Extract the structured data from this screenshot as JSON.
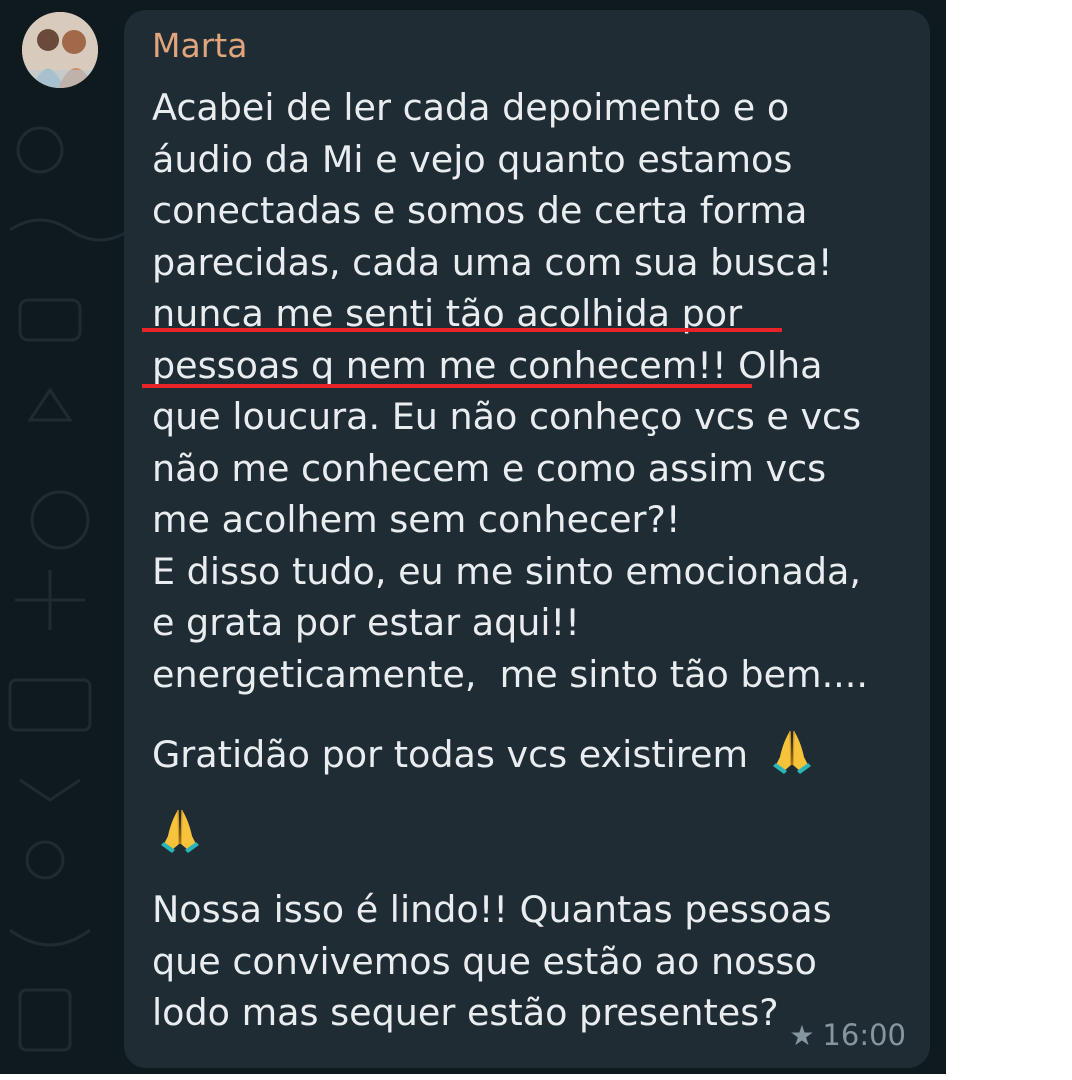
{
  "message": {
    "sender": "Marta",
    "lines": [
      "Acabei de ler cada depoimento e o",
      "áudio da Mi e vejo quanto estamos",
      "conectadas e somos de certa forma",
      "parecidas, cada uma com sua busca!",
      "nunca me senti tão acolhida por",
      "pessoas q nem me conhecem!! Olha",
      "que loucura. Eu não conheço vcs e vcs",
      "não me conhecem e como assim vcs",
      "me acolhem sem conhecer?!",
      "E disso tudo, eu me sinto emocionada,",
      "e grata por estar aqui!!",
      "energeticamente,  me sinto tão bem....",
      "Gratidão por todas vcs existirem",
      "Nossa isso é lindo!! Quantas pessoas",
      "que convivemos que estão ao nosso",
      "lodo mas sequer estão presentes?"
    ],
    "emoji": "folded-hands-icon",
    "starred": true,
    "time": "16:00"
  },
  "colors": {
    "background": "#0f1a1f",
    "bubble": "#1f2c34",
    "sender_name": "#e0a57c",
    "text": "#e9edef",
    "meta": "#8696a0",
    "underline": "#e8232a"
  }
}
